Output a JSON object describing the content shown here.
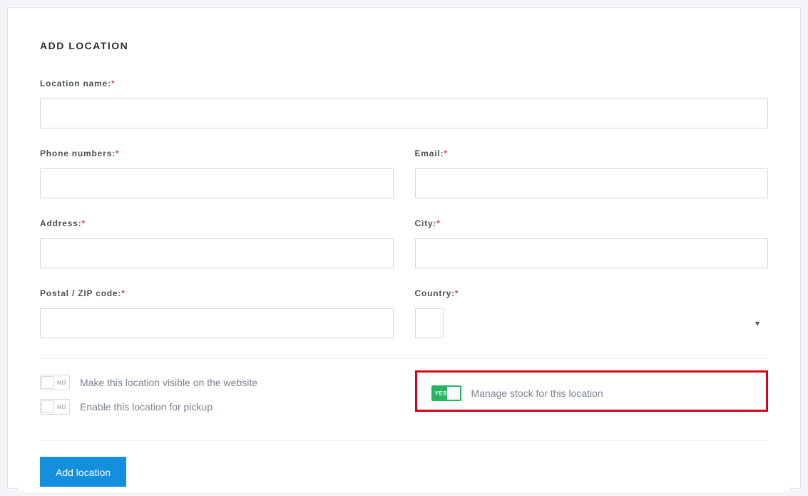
{
  "page_title": "ADD LOCATION",
  "fields": {
    "location_name": {
      "label": "Location name:",
      "required": true
    },
    "phone": {
      "label": "Phone numbers:",
      "required": true
    },
    "email": {
      "label": "Email:",
      "required": true
    },
    "address": {
      "label": "Address:",
      "required": true
    },
    "city": {
      "label": "City:",
      "required": true
    },
    "postal": {
      "label": "Postal / ZIP code:",
      "required": true
    },
    "country": {
      "label": "Country:",
      "required": true
    }
  },
  "toggles": {
    "visible": {
      "label": "Make this location visible on the website",
      "state": "NO"
    },
    "pickup": {
      "label": "Enable this location for pickup",
      "state": "NO"
    },
    "stock": {
      "label": "Manage stock for this location",
      "state": "YES"
    }
  },
  "submit_label": "Add location",
  "required_mark": "*"
}
